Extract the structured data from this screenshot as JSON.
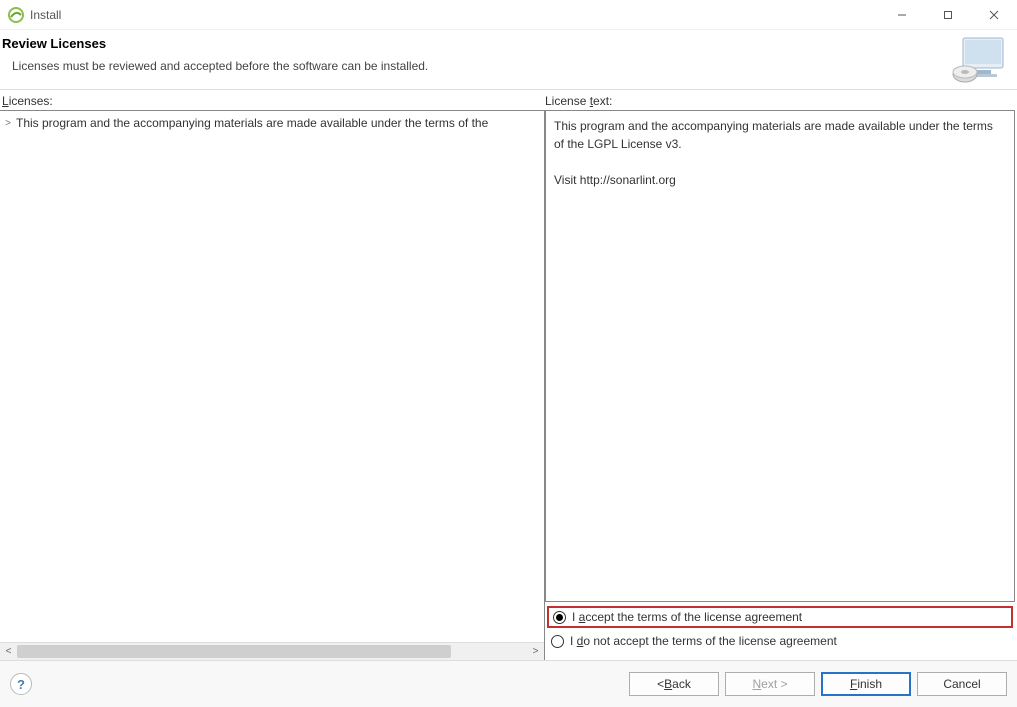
{
  "window": {
    "title": "Install"
  },
  "header": {
    "title": "Review Licenses",
    "subtitle": "Licenses must be reviewed and accepted before the software can be installed."
  },
  "labels": {
    "licenses_prefix_u": "L",
    "licenses_rest": "icenses:",
    "license_text_prefix": "License ",
    "license_text_u": "t",
    "license_text_rest": "ext:"
  },
  "tree": {
    "items": [
      {
        "expander": ">",
        "label": "This program and the accompanying materials are made available under the terms of the"
      }
    ]
  },
  "license_body": "This program and the accompanying materials are made available under the terms of the LGPL License v3.\n\nVisit http://sonarlint.org",
  "radios": {
    "accept_pre": "I ",
    "accept_u": "a",
    "accept_post": "ccept the terms of the license agreement",
    "reject_pre": "I ",
    "reject_u": "d",
    "reject_post": "o not accept the terms of the license agreement",
    "selected": "accept"
  },
  "buttons": {
    "back_pre": "< ",
    "back_u": "B",
    "back_post": "ack",
    "next_u": "N",
    "next_post": "ext >",
    "finish_u": "F",
    "finish_post": "inish",
    "cancel": "Cancel",
    "help": "?"
  }
}
